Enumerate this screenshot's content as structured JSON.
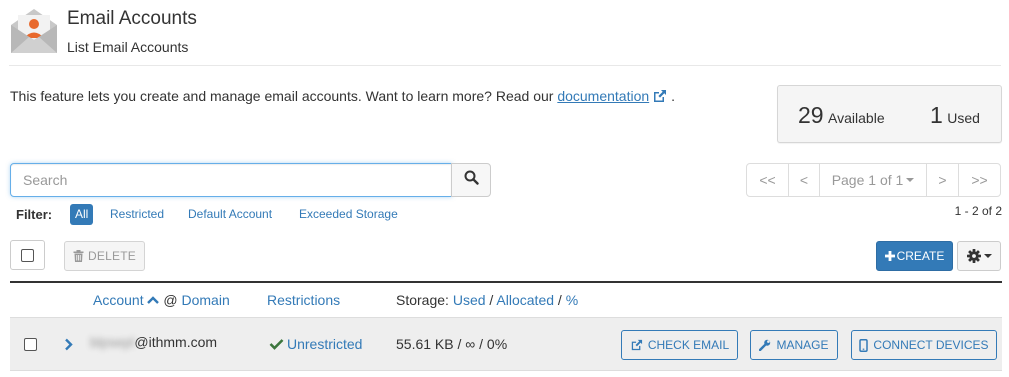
{
  "header": {
    "title": "Email Accounts",
    "subtitle": "List Email Accounts",
    "icon": "email-envelope-user-icon"
  },
  "intro": {
    "text": "This feature lets you create and manage email accounts. Want to learn more? Read our",
    "link_label": "documentation",
    "trailing": "."
  },
  "stats": {
    "available_count": "29",
    "available_label": "Available",
    "used_count": "1",
    "used_label": "Used"
  },
  "search": {
    "placeholder": "Search",
    "value": ""
  },
  "pagination": {
    "first": "<<",
    "prev": "<",
    "page_label": "Page 1 of 1",
    "next": ">",
    "last": ">>",
    "range": "1 - 2 of 2"
  },
  "filter": {
    "label": "Filter:",
    "options": [
      "All",
      "Restricted",
      "Default Account",
      "Exceeded Storage"
    ],
    "active": "All"
  },
  "toolbar": {
    "delete_label": "DELETE",
    "create_label": "CREATE"
  },
  "table": {
    "col_account": "Account",
    "col_at": "@",
    "col_domain": "Domain",
    "col_restrictions": "Restrictions",
    "col_storage_prefix": "Storage:",
    "col_storage_used": "Used",
    "col_storage_allocated": "Allocated",
    "col_storage_percent": "%",
    "sep": "/",
    "rows": [
      {
        "account_user": "blpsepl",
        "account_domain": "@ithmm.com",
        "restriction": "Unrestricted",
        "storage": "55.61 KB / ∞ / 0%",
        "check_email_label": "CHECK EMAIL",
        "manage_label": "MANAGE",
        "connect_label": "CONNECT DEVICES"
      }
    ]
  },
  "colors": {
    "accent": "#337ab7",
    "success": "#3c763d",
    "icon_orange": "#e8692d"
  }
}
